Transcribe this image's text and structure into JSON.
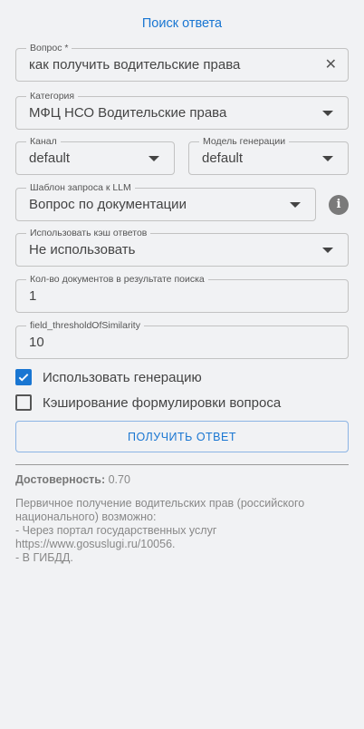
{
  "header": {
    "title": "Поиск ответа"
  },
  "form": {
    "question": {
      "label": "Вопрос *",
      "value": "как получить водительские права",
      "clear_icon": "close-icon"
    },
    "category": {
      "label": "Категория",
      "value": "МФЦ НСО Водительские права"
    },
    "channel": {
      "label": "Канал",
      "value": "default"
    },
    "model": {
      "label": "Модель генерации",
      "value": "default"
    },
    "template": {
      "label": "Шаблон запроса к LLM",
      "value": "Вопрос по документации",
      "info_icon": "info-icon"
    },
    "cache": {
      "label": "Использовать кэш ответов",
      "value": "Не использовать"
    },
    "doc_count": {
      "label": "Кол-во документов в результате поиска",
      "value": "1"
    },
    "threshold": {
      "label": "field_thresholdOfSimilarity",
      "value": "10"
    },
    "use_generation": {
      "label": "Использовать генерацию",
      "checked": true
    },
    "cache_wording": {
      "label": "Кэширование формулировки вопроса",
      "checked": false
    },
    "submit_label": "ПОЛУЧИТЬ ОТВЕТ"
  },
  "result": {
    "reliability_label": "Достоверность:",
    "reliability_value": "0.70",
    "answer": "Первичное получение водительских прав (российского национального) возможно:\n- Через портал государственных услуг https://www.gosuslugi.ru/10056.\n- В ГИБДД."
  },
  "colors": {
    "accent": "#1976d2",
    "background": "#f1f2f4"
  }
}
